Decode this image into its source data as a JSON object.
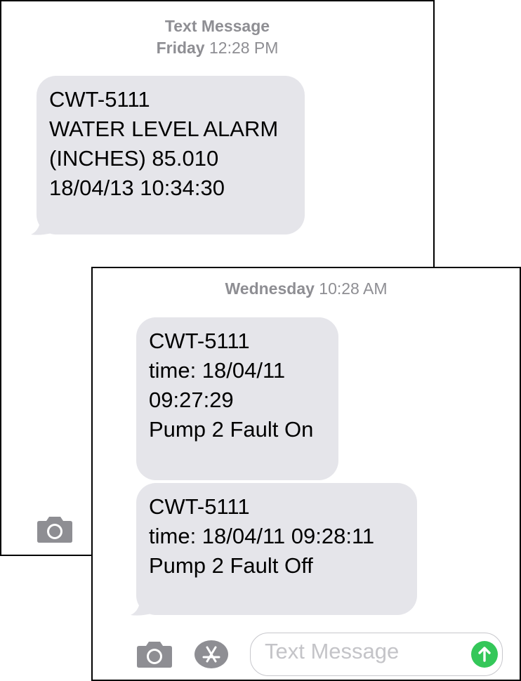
{
  "back_screen": {
    "header": {
      "title": "Text Message",
      "day": "Friday",
      "time": "12:28 PM"
    },
    "message": {
      "lines": [
        "CWT-5111",
        "WATER LEVEL ALARM",
        "(INCHES) 85.010",
        "18/04/13 10:34:30"
      ]
    },
    "toolbar": {
      "camera_icon": "camera-icon"
    }
  },
  "front_screen": {
    "header": {
      "day": "Wednesday",
      "time": "10:28 AM"
    },
    "messages": [
      {
        "lines": [
          "CWT-5111",
          "time: 18/04/11",
          "09:27:29",
          "Pump 2 Fault On"
        ]
      },
      {
        "lines": [
          "CWT-5111",
          "time: 18/04/11 09:28:11",
          "Pump 2 Fault Off"
        ]
      }
    ],
    "toolbar": {
      "camera_icon": "camera-icon",
      "appstore_icon": "app-store-icon",
      "input_placeholder": "Text Message",
      "send_icon": "send-arrow-icon"
    }
  },
  "colors": {
    "bubble": "#e5e5ea",
    "header_text": "#8e8e93",
    "send": "#34c759",
    "icon": "#8e8e93"
  }
}
